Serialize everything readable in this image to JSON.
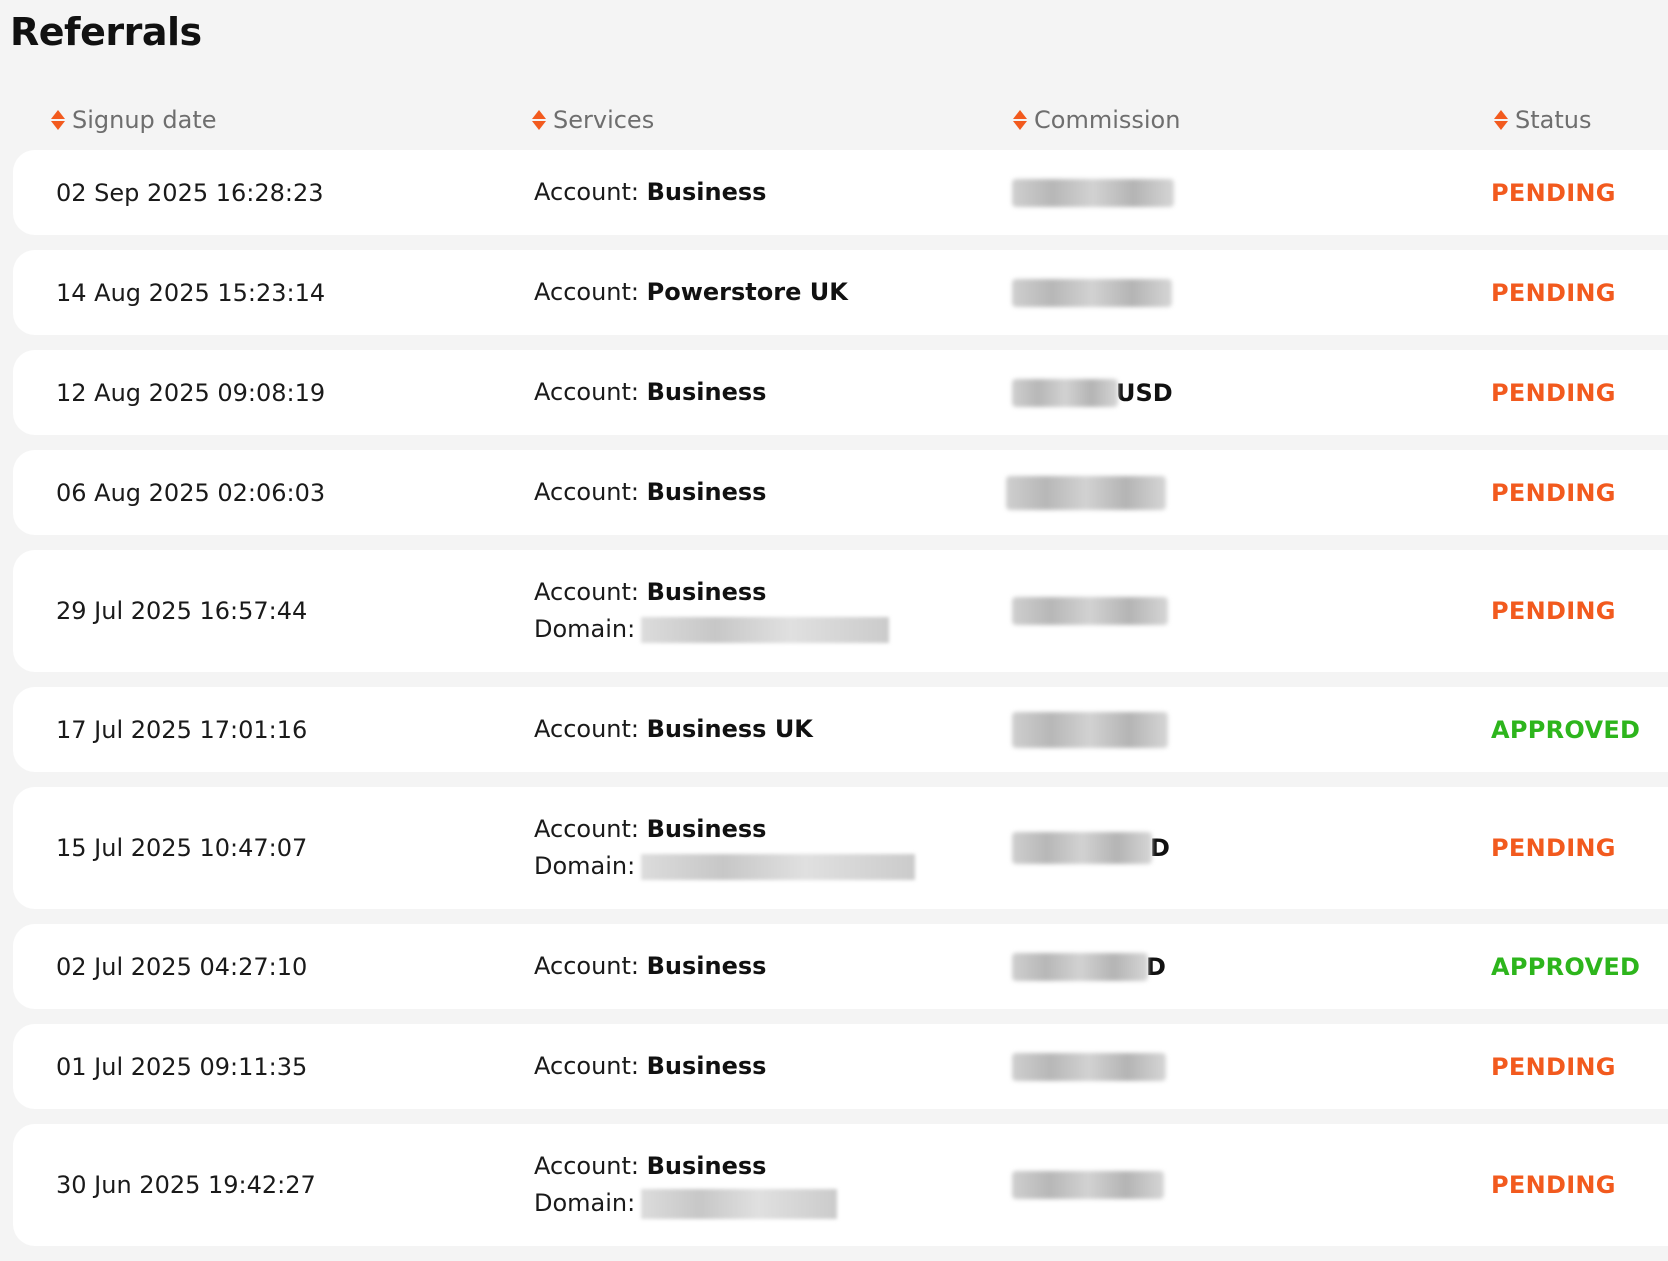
{
  "page": {
    "title": "Referrals"
  },
  "colors": {
    "pending": "#f25a1e",
    "approved": "#2db51c",
    "sort_up": "#f25a1e",
    "sort_down": "#f25a1e"
  },
  "table": {
    "headers": {
      "signup_date": "Signup date",
      "services": "Services",
      "commission": "Commission",
      "status": "Status"
    },
    "account_label": "Account:",
    "domain_label": "Domain:",
    "rows": [
      {
        "date": "02 Sep 2025 16:28:23",
        "account": "Business",
        "commission_suffix": "",
        "status": "PENDING"
      },
      {
        "date": "14 Aug 2025 15:23:14",
        "account": "Powerstore UK",
        "commission_suffix": "",
        "status": "PENDING"
      },
      {
        "date": "12 Aug 2025 09:08:19",
        "account": "Business",
        "commission_suffix": "USD",
        "status": "PENDING"
      },
      {
        "date": "06 Aug 2025 02:06:03",
        "account": "Business",
        "commission_suffix": "",
        "status": "PENDING"
      },
      {
        "date": "29 Jul 2025 16:57:44",
        "account": "Business",
        "commission_suffix": "",
        "status": "PENDING"
      },
      {
        "date": "17 Jul 2025 17:01:16",
        "account": "Business UK",
        "commission_suffix": "",
        "status": "APPROVED"
      },
      {
        "date": "15 Jul 2025 10:47:07",
        "account": "Business",
        "commission_suffix": "D",
        "status": "PENDING"
      },
      {
        "date": "02 Jul 2025 04:27:10",
        "account": "Business",
        "commission_suffix": "D",
        "status": "APPROVED"
      },
      {
        "date": "01 Jul 2025 09:11:35",
        "account": "Business",
        "commission_suffix": "",
        "status": "PENDING"
      },
      {
        "date": "30 Jun 2025 19:42:27",
        "account": "Business",
        "commission_suffix": "",
        "status": "PENDING"
      }
    ]
  }
}
